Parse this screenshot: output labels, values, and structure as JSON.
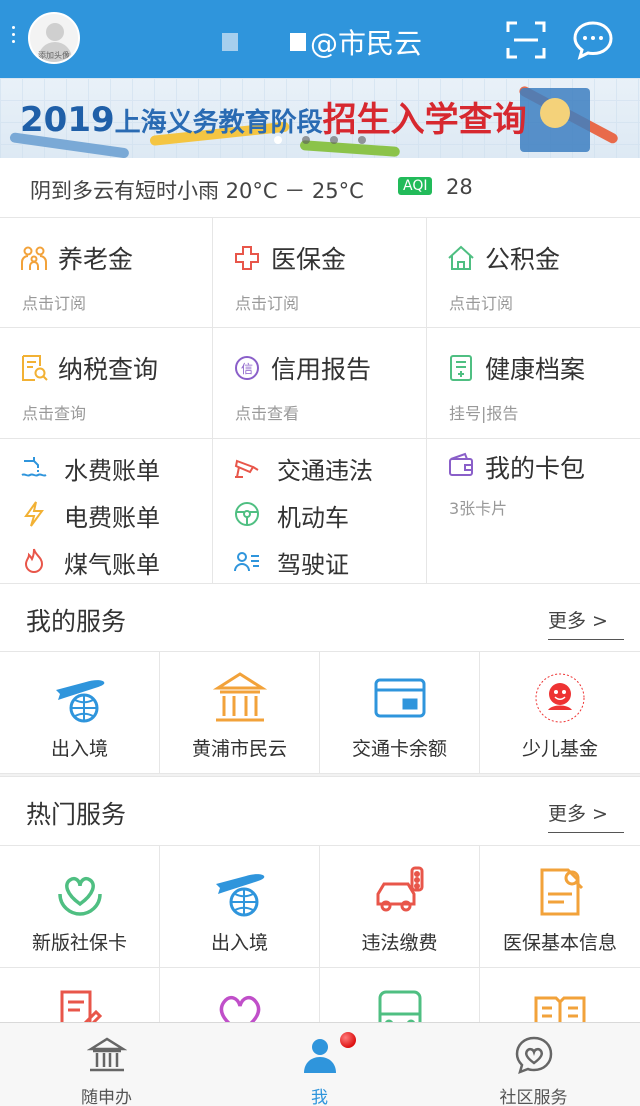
{
  "header": {
    "app_title": "@市民云",
    "avatar_caption": "添加头像",
    "icons": {
      "menu": "vertical-dots-icon",
      "scan": "scan-frame-icon",
      "message": "chat-bubble-icon"
    }
  },
  "banner": {
    "year": "2019",
    "middle": "上海义务教育阶段",
    "highlight": "招生入学查询",
    "page_count": 4,
    "active_page": 1
  },
  "weather": {
    "text": "阴到多云有短时小雨 20°C － 25°C",
    "aqi_label": "AQI",
    "aqi_value": "28"
  },
  "quick_cards": [
    {
      "title": "养老金",
      "sub": "点击订阅",
      "icon": "family-icon",
      "color": "#f2a23a"
    },
    {
      "title": "医保金",
      "sub": "点击订阅",
      "icon": "medical-cross-icon",
      "color": "#e8564a"
    },
    {
      "title": "公积金",
      "sub": "点击订阅",
      "icon": "house-icon",
      "color": "#4fbf82"
    },
    {
      "title": "纳税查询",
      "sub": "点击查询",
      "icon": "tax-doc-icon",
      "color": "#f2b134"
    },
    {
      "title": "信用报告",
      "sub": "点击查看",
      "icon": "credit-icon",
      "color": "#8a5fc9"
    },
    {
      "title": "健康档案",
      "sub": "挂号|报告",
      "icon": "health-file-icon",
      "color": "#4fbf82"
    }
  ],
  "bills": [
    {
      "title": "水费账单",
      "icon": "water-tap-icon",
      "color": "#2f95dc"
    },
    {
      "title": "电费账单",
      "icon": "lightning-icon",
      "color": "#f2b134"
    },
    {
      "title": "煤气账单",
      "icon": "flame-icon",
      "color": "#e8564a"
    }
  ],
  "traffic": [
    {
      "title": "交通违法",
      "icon": "camera-icon",
      "color": "#e8564a"
    },
    {
      "title": "机动车",
      "icon": "steering-wheel-icon",
      "color": "#4fbf82"
    },
    {
      "title": "驾驶证",
      "icon": "license-icon",
      "color": "#2f95dc"
    }
  ],
  "wallet": {
    "title": "我的卡包",
    "sub": "3张卡片",
    "icon": "wallet-icon",
    "color": "#8a5fc9"
  },
  "my_services": {
    "title": "我的服务",
    "more": "更多 >",
    "items": [
      {
        "label": "出入境",
        "icon": "plane-globe-icon"
      },
      {
        "label": "黄浦市民云",
        "icon": "building-icon"
      },
      {
        "label": "交通卡余额",
        "icon": "transit-card-icon"
      },
      {
        "label": "少儿基金",
        "icon": "kids-fund-logo-icon"
      }
    ]
  },
  "hot_services": {
    "title": "热门服务",
    "more": "更多 >",
    "items": [
      {
        "label": "新版社保卡",
        "icon": "heart-hands-icon"
      },
      {
        "label": "出入境",
        "icon": "plane-globe-icon"
      },
      {
        "label": "违法缴费",
        "icon": "car-traffic-light-icon"
      },
      {
        "label": "医保基本信息",
        "icon": "medical-doc-icon"
      },
      {
        "label": "",
        "icon": "edit-doc-icon"
      },
      {
        "label": "",
        "icon": "heart-icon"
      },
      {
        "label": "",
        "icon": "bus-icon"
      },
      {
        "label": "",
        "icon": "book-icon"
      }
    ]
  },
  "bottom_nav": [
    {
      "label": "随申办",
      "icon": "government-building-icon",
      "active": false
    },
    {
      "label": "我",
      "icon": "person-icon",
      "active": true
    },
    {
      "label": "社区服务",
      "icon": "heart-chat-icon",
      "active": false
    }
  ]
}
